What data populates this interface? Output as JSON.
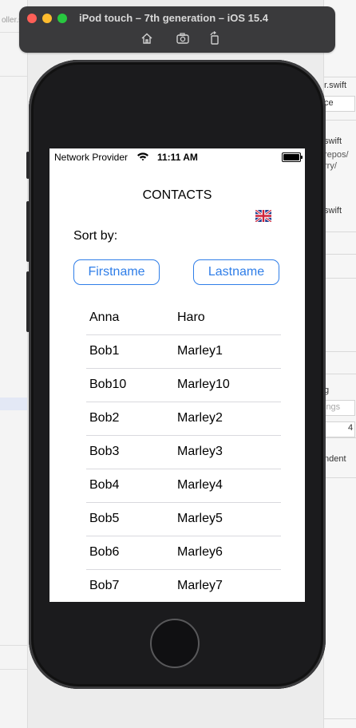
{
  "simulator": {
    "title": "iPod touch – 7th generation – iOS 15.4",
    "icons": [
      "home-icon",
      "screenshot-icon",
      "rotate-icon"
    ]
  },
  "ide_background": {
    "left_tab_text": "oller.s",
    "right_texts": [
      "r.swift",
      "ce",
      "swift",
      "repos/",
      "rry/",
      "swift",
      "g",
      "ings",
      "4",
      "ndent"
    ]
  },
  "status_bar": {
    "carrier": "Network Provider",
    "time": "11:11 AM"
  },
  "app": {
    "title": "CONTACTS",
    "flag_icon": "uk-flag-icon",
    "sort_label": "Sort by:",
    "sort_firstname": "Firstname",
    "sort_lastname": "Lastname",
    "accent_color": "#2f7ee8",
    "contacts": [
      {
        "first": "Anna",
        "last": "Haro"
      },
      {
        "first": "Bob1",
        "last": "Marley1"
      },
      {
        "first": "Bob10",
        "last": "Marley10"
      },
      {
        "first": "Bob2",
        "last": "Marley2"
      },
      {
        "first": "Bob3",
        "last": "Marley3"
      },
      {
        "first": "Bob4",
        "last": "Marley4"
      },
      {
        "first": "Bob5",
        "last": "Marley5"
      },
      {
        "first": "Bob6",
        "last": "Marley6"
      },
      {
        "first": "Bob7",
        "last": "Marley7"
      }
    ]
  }
}
